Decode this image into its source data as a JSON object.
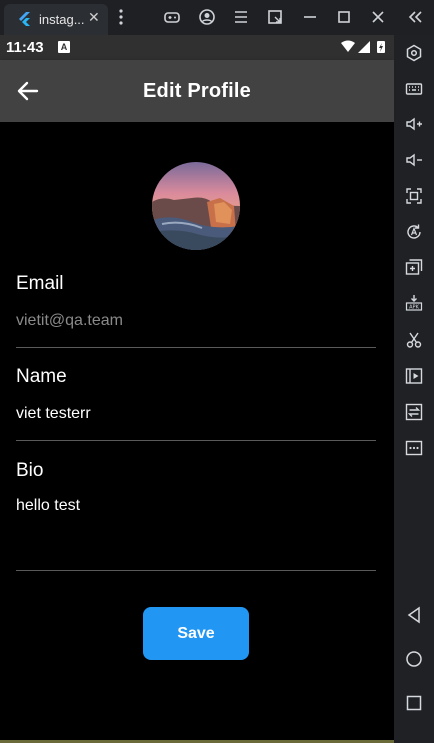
{
  "window": {
    "tab_title": "instag...",
    "tab_close": "✕"
  },
  "statusbar": {
    "time": "11:43",
    "notification_badge": "A"
  },
  "appbar": {
    "title": "Edit Profile"
  },
  "form": {
    "email": {
      "label": "Email",
      "value": "vietit@qa.team"
    },
    "name": {
      "label": "Name",
      "value": "viet testerr"
    },
    "bio": {
      "label": "Bio",
      "value": "hello test"
    }
  },
  "actions": {
    "save_label": "Save",
    "save_color": "#2196f3"
  },
  "icons": {
    "titlebar": [
      "flutter-icon",
      "gamepad-icon",
      "account-icon",
      "menu-icon",
      "resize-icon",
      "minimize-icon",
      "maximize-icon",
      "close-icon",
      "collapse-icon"
    ],
    "sidebar": [
      "settings-icon",
      "keyboard-icon",
      "volume-up-icon",
      "volume-down-icon",
      "screenshot-icon",
      "rotate-icon",
      "multi-instance-icon",
      "apk-icon",
      "cut-icon",
      "media-icon",
      "sync-icon",
      "more-icon",
      "back-nav-icon",
      "home-nav-icon",
      "recents-nav-icon"
    ]
  }
}
